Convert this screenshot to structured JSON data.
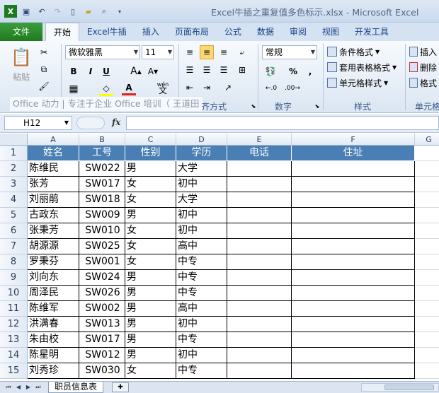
{
  "window": {
    "title": "Excel牛插之重复值多色标示.xlsx  -  Microsoft Excel"
  },
  "qat": {
    "save_icon": "save-icon",
    "undo_icon": "undo-icon",
    "redo_icon": "redo-icon"
  },
  "tabs": [
    "文件",
    "开始",
    "Excel牛插",
    "插入",
    "页面布局",
    "公式",
    "数据",
    "审阅",
    "视图",
    "开发工具"
  ],
  "ribbon": {
    "paste_label": "粘贴",
    "font_name": "微软雅黑",
    "font_size": "11",
    "number_format": "常规",
    "bold": "B",
    "italic": "I",
    "underline": "U",
    "font_color_glyph": "A",
    "wen": "wén",
    "wen_char": "文",
    "percent": "%",
    "comma": ",",
    "dec_inc": "←.0",
    "dec_dec": ".00→",
    "conditional_format": "条件格式",
    "table_format": "套用表格格式",
    "cell_style": "单元格样式",
    "insert": "插入",
    "delete": "删除",
    "format": "格式",
    "group_alignment": "齐方式",
    "group_number": "数字",
    "group_style": "样式",
    "group_cells": "单元格",
    "watermark": "Office 动力 | 专注于企业 Office 培训（ 王道田"
  },
  "formula_bar": {
    "name_box": "H12",
    "fx": "fx",
    "formula": ""
  },
  "sheet": {
    "columns": [
      "A",
      "B",
      "C",
      "D",
      "E",
      "F",
      "G"
    ],
    "row_numbers": [
      "1",
      "2",
      "3",
      "4",
      "5",
      "6",
      "7",
      "8",
      "9",
      "10",
      "11",
      "12",
      "13",
      "14",
      "15"
    ],
    "headers": [
      "姓名",
      "工号",
      "性别",
      "学历",
      "电话",
      "住址"
    ],
    "rows": [
      [
        "陈维民",
        "SW022",
        "男",
        "大学",
        "",
        ""
      ],
      [
        "张芳",
        "SW017",
        "女",
        "初中",
        "",
        ""
      ],
      [
        "刘丽鹃",
        "SW018",
        "女",
        "大学",
        "",
        ""
      ],
      [
        "古政东",
        "SW009",
        "男",
        "初中",
        "",
        ""
      ],
      [
        "张秉芳",
        "SW010",
        "女",
        "初中",
        "",
        ""
      ],
      [
        "胡源源",
        "SW025",
        "女",
        "高中",
        "",
        ""
      ],
      [
        "罗秉芬",
        "SW001",
        "女",
        "中专",
        "",
        ""
      ],
      [
        "刘向东",
        "SW024",
        "男",
        "中专",
        "",
        ""
      ],
      [
        "周泽民",
        "SW026",
        "男",
        "中专",
        "",
        ""
      ],
      [
        "陈维军",
        "SW002",
        "男",
        "高中",
        "",
        ""
      ],
      [
        "洪满春",
        "SW013",
        "男",
        "初中",
        "",
        ""
      ],
      [
        "朱由校",
        "SW017",
        "男",
        "中专",
        "",
        ""
      ],
      [
        "陈星明",
        "SW012",
        "男",
        "初中",
        "",
        ""
      ],
      [
        "刘秀珍",
        "SW030",
        "女",
        "中专",
        "",
        ""
      ]
    ],
    "header_bg": "#4a7fb5"
  },
  "sheet_tabs": {
    "active": "职员信息表"
  }
}
